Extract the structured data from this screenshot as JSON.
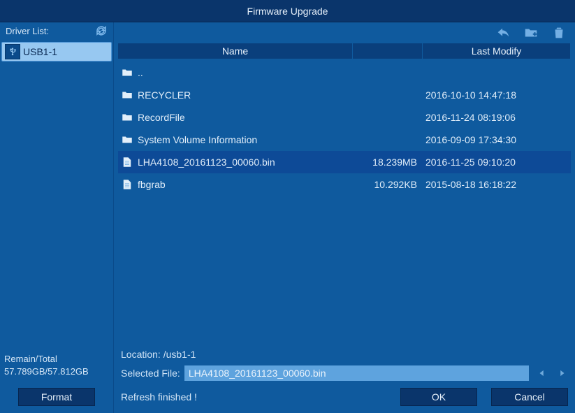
{
  "title": "Firmware Upgrade",
  "sidebar": {
    "label": "Driver List:",
    "drivers": [
      {
        "label": "USB1-1"
      }
    ],
    "stats_label": "Remain/Total",
    "stats_value": "57.789GB/57.812GB",
    "format_label": "Format"
  },
  "columns": {
    "name": "Name",
    "modify": "Last Modify"
  },
  "files": [
    {
      "type": "folder",
      "name": "..",
      "size": "",
      "modify": "",
      "sel": false
    },
    {
      "type": "folder",
      "name": "RECYCLER",
      "size": "",
      "modify": "2016-10-10 14:47:18",
      "sel": false
    },
    {
      "type": "folder",
      "name": "RecordFile",
      "size": "",
      "modify": "2016-11-24 08:19:06",
      "sel": false
    },
    {
      "type": "folder",
      "name": "System Volume Information",
      "size": "",
      "modify": "2016-09-09 17:34:30",
      "sel": false
    },
    {
      "type": "file",
      "name": "LHA4108_20161123_00060.bin",
      "size": "18.239MB",
      "modify": "2016-11-25 09:10:20",
      "sel": true
    },
    {
      "type": "file",
      "name": "fbgrab",
      "size": "10.292KB",
      "modify": "2015-08-18 16:18:22",
      "sel": false
    }
  ],
  "location_label": "Location:",
  "location_value": "/usb1-1",
  "selected_label": "Selected File:",
  "selected_value": "LHA4108_20161123_00060.bin",
  "status": "Refresh finished !",
  "ok": "OK",
  "cancel": "Cancel"
}
